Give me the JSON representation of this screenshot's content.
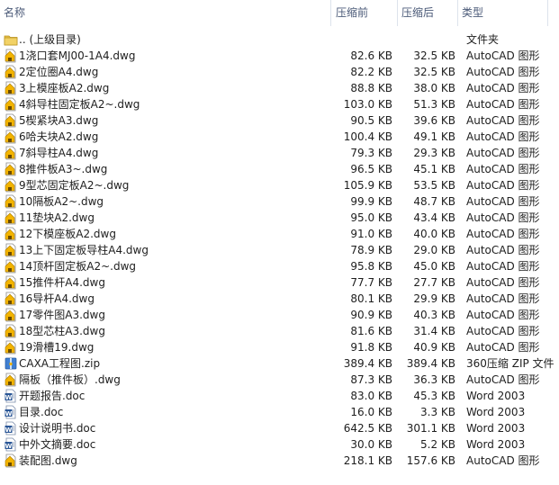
{
  "header": {
    "name_label": "名称",
    "compressed_label": "压缩前",
    "size_label": "压缩后",
    "type_label": "类型"
  },
  "colors": {
    "folder": "#e8c24a",
    "autocad": "#f3b400",
    "doc": "#2b5797"
  },
  "files": [
    {
      "name": ".. (上级目录)",
      "orig": "",
      "comp": "",
      "type": "文件夹",
      "icon": "folder-icon"
    },
    {
      "name": "1浇口套MJ00-1A4.dwg",
      "orig": "82.6 KB",
      "comp": "32.5 KB",
      "type": "AutoCAD 图形",
      "icon": "autocad-file-icon"
    },
    {
      "name": "2定位圈A4.dwg",
      "orig": "82.2 KB",
      "comp": "32.5 KB",
      "type": "AutoCAD 图形",
      "icon": "autocad-file-icon"
    },
    {
      "name": "3上模座板A2.dwg",
      "orig": "88.8 KB",
      "comp": "38.0 KB",
      "type": "AutoCAD 图形",
      "icon": "autocad-file-icon"
    },
    {
      "name": "4斜导柱固定板A2~.dwg",
      "orig": "103.0 KB",
      "comp": "51.3 KB",
      "type": "AutoCAD 图形",
      "icon": "autocad-file-icon"
    },
    {
      "name": "5楔紧块A3.dwg",
      "orig": "90.5 KB",
      "comp": "39.6 KB",
      "type": "AutoCAD 图形",
      "icon": "autocad-file-icon"
    },
    {
      "name": "6哈夫块A2.dwg",
      "orig": "100.4 KB",
      "comp": "49.1 KB",
      "type": "AutoCAD 图形",
      "icon": "autocad-file-icon"
    },
    {
      "name": "7斜导柱A4.dwg",
      "orig": "79.3 KB",
      "comp": "29.3 KB",
      "type": "AutoCAD 图形",
      "icon": "autocad-file-icon"
    },
    {
      "name": "8推件板A3~.dwg",
      "orig": "96.5 KB",
      "comp": "45.1 KB",
      "type": "AutoCAD 图形",
      "icon": "autocad-file-icon"
    },
    {
      "name": "9型芯固定板A2~.dwg",
      "orig": "105.9 KB",
      "comp": "53.5 KB",
      "type": "AutoCAD 图形",
      "icon": "autocad-file-icon"
    },
    {
      "name": "10隔板A2~.dwg",
      "orig": "99.9 KB",
      "comp": "48.7 KB",
      "type": "AutoCAD 图形",
      "icon": "autocad-file-icon"
    },
    {
      "name": "11垫块A2.dwg",
      "orig": "95.0 KB",
      "comp": "43.4 KB",
      "type": "AutoCAD 图形",
      "icon": "autocad-file-icon"
    },
    {
      "name": "12下模座板A2.dwg",
      "orig": "91.0 KB",
      "comp": "40.0 KB",
      "type": "AutoCAD 图形",
      "icon": "autocad-file-icon"
    },
    {
      "name": "13上下固定板导柱A4.dwg",
      "orig": "78.9 KB",
      "comp": "29.0 KB",
      "type": "AutoCAD 图形",
      "icon": "autocad-file-icon"
    },
    {
      "name": "14顶杆固定板A2~.dwg",
      "orig": "95.8 KB",
      "comp": "45.0 KB",
      "type": "AutoCAD 图形",
      "icon": "autocad-file-icon"
    },
    {
      "name": "15推件杆A4.dwg",
      "orig": "77.7 KB",
      "comp": "27.7 KB",
      "type": "AutoCAD 图形",
      "icon": "autocad-file-icon"
    },
    {
      "name": "16导杆A4.dwg",
      "orig": "80.1 KB",
      "comp": "29.9 KB",
      "type": "AutoCAD 图形",
      "icon": "autocad-file-icon"
    },
    {
      "name": "17零件图A3.dwg",
      "orig": "90.9 KB",
      "comp": "40.3 KB",
      "type": "AutoCAD 图形",
      "icon": "autocad-file-icon"
    },
    {
      "name": "18型芯柱A3.dwg",
      "orig": "81.6 KB",
      "comp": "31.4 KB",
      "type": "AutoCAD 图形",
      "icon": "autocad-file-icon"
    },
    {
      "name": "19滑槽19.dwg",
      "orig": "91.8 KB",
      "comp": "40.9 KB",
      "type": "AutoCAD 图形",
      "icon": "autocad-file-icon"
    },
    {
      "name": "CAXA工程图.zip",
      "orig": "389.4 KB",
      "comp": "389.4 KB",
      "type": "360压缩 ZIP 文件",
      "icon": "zip-file-icon"
    },
    {
      "name": "隔板（推件板）.dwg",
      "orig": "87.3 KB",
      "comp": "36.3 KB",
      "type": "AutoCAD 图形",
      "icon": "autocad-file-icon"
    },
    {
      "name": "开题报告.doc",
      "orig": "83.0 KB",
      "comp": "45.3 KB",
      "type": "Word 2003",
      "icon": "word-doc-icon"
    },
    {
      "name": "目录.doc",
      "orig": "16.0 KB",
      "comp": "3.3 KB",
      "type": "Word 2003",
      "icon": "word-doc-icon"
    },
    {
      "name": "设计说明书.doc",
      "orig": "642.5 KB",
      "comp": "301.1 KB",
      "type": "Word 2003",
      "icon": "word-doc-icon"
    },
    {
      "name": "中外文摘要.doc",
      "orig": "30.0 KB",
      "comp": "5.2 KB",
      "type": "Word 2003",
      "icon": "word-doc-icon"
    },
    {
      "name": "装配图.dwg",
      "orig": "218.1 KB",
      "comp": "157.6 KB",
      "type": "AutoCAD 图形",
      "icon": "autocad-file-icon"
    }
  ]
}
